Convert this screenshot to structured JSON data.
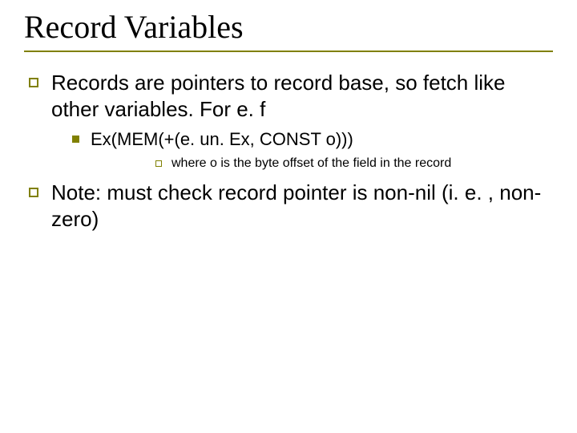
{
  "slide": {
    "title": "Record Variables",
    "bullets": [
      {
        "text": "Records are pointers to record base, so fetch like other variables. For e. f",
        "children": [
          {
            "text": "Ex(MEM(+(e. un. Ex, CONST o)))",
            "children": [
              {
                "text": "where o is the byte offset of the field in the record"
              }
            ]
          }
        ]
      },
      {
        "text": "Note: must check record pointer is non-nil (i. e. , non-zero)"
      }
    ]
  }
}
